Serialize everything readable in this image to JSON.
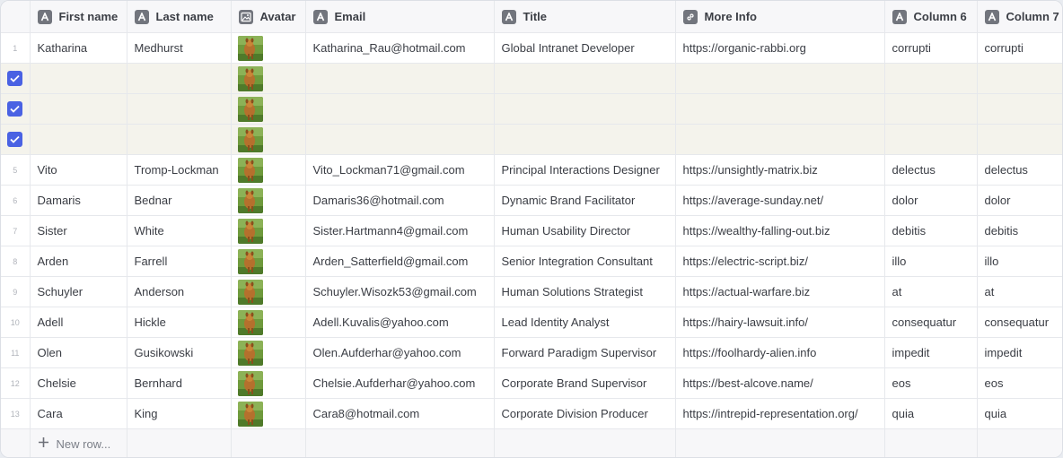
{
  "columns": [
    {
      "label": "First name",
      "icon": "text-type-icon"
    },
    {
      "label": "Last name",
      "icon": "text-type-icon"
    },
    {
      "label": "Avatar",
      "icon": "image-type-icon"
    },
    {
      "label": "Email",
      "icon": "text-type-icon"
    },
    {
      "label": "Title",
      "icon": "text-type-icon"
    },
    {
      "label": "More Info",
      "icon": "link-type-icon"
    },
    {
      "label": "Column 6",
      "icon": "text-type-icon"
    },
    {
      "label": "Column 7",
      "icon": "text-type-icon"
    }
  ],
  "rows": [
    {
      "num": "1",
      "selected": false,
      "first": "Katharina",
      "last": "Medhurst",
      "email": "Katharina_Rau@hotmail.com",
      "title": "Global Intranet Developer",
      "info": "https://organic-rabbi.org",
      "c6": "corrupti",
      "c7": "corrupti"
    },
    {
      "num": "",
      "selected": true,
      "first": "",
      "last": "",
      "email": "",
      "title": "",
      "info": "",
      "c6": "",
      "c7": ""
    },
    {
      "num": "",
      "selected": true,
      "first": "",
      "last": "",
      "email": "",
      "title": "",
      "info": "",
      "c6": "",
      "c7": ""
    },
    {
      "num": "",
      "selected": true,
      "first": "",
      "last": "",
      "email": "",
      "title": "",
      "info": "",
      "c6": "",
      "c7": ""
    },
    {
      "num": "5",
      "selected": false,
      "first": "Vito",
      "last": "Tromp-Lockman",
      "email": "Vito_Lockman71@gmail.com",
      "title": "Principal Interactions Designer",
      "info": "https://unsightly-matrix.biz",
      "c6": "delectus",
      "c7": "delectus"
    },
    {
      "num": "6",
      "selected": false,
      "first": "Damaris",
      "last": "Bednar",
      "email": "Damaris36@hotmail.com",
      "title": "Dynamic Brand Facilitator",
      "info": "https://average-sunday.net/",
      "c6": "dolor",
      "c7": "dolor"
    },
    {
      "num": "7",
      "selected": false,
      "first": "Sister",
      "last": "White",
      "email": "Sister.Hartmann4@gmail.com",
      "title": "Human Usability Director",
      "info": "https://wealthy-falling-out.biz",
      "c6": "debitis",
      "c7": "debitis"
    },
    {
      "num": "8",
      "selected": false,
      "first": "Arden",
      "last": "Farrell",
      "email": "Arden_Satterfield@gmail.com",
      "title": "Senior Integration Consultant",
      "info": "https://electric-script.biz/",
      "c6": "illo",
      "c7": "illo"
    },
    {
      "num": "9",
      "selected": false,
      "first": "Schuyler",
      "last": "Anderson",
      "email": "Schuyler.Wisozk53@gmail.com",
      "title": "Human Solutions Strategist",
      "info": "https://actual-warfare.biz",
      "c6": "at",
      "c7": "at"
    },
    {
      "num": "10",
      "selected": false,
      "first": "Adell",
      "last": "Hickle",
      "email": "Adell.Kuvalis@yahoo.com",
      "title": "Lead Identity Analyst",
      "info": "https://hairy-lawsuit.info/",
      "c6": "consequatur",
      "c7": "consequatur"
    },
    {
      "num": "11",
      "selected": false,
      "first": "Olen",
      "last": "Gusikowski",
      "email": "Olen.Aufderhar@yahoo.com",
      "title": "Forward Paradigm Supervisor",
      "info": "https://foolhardy-alien.info",
      "c6": "impedit",
      "c7": "impedit"
    },
    {
      "num": "12",
      "selected": false,
      "first": "Chelsie",
      "last": "Bernhard",
      "email": "Chelsie.Aufderhar@yahoo.com",
      "title": "Corporate Brand Supervisor",
      "info": "https://best-alcove.name/",
      "c6": "eos",
      "c7": "eos"
    },
    {
      "num": "13",
      "selected": false,
      "first": "Cara",
      "last": "King",
      "email": "Cara8@hotmail.com",
      "title": "Corporate Division Producer",
      "info": "https://intrepid-representation.org/",
      "c6": "quia",
      "c7": "quia"
    }
  ],
  "new_row_label": "New row...",
  "colors": {
    "accent": "#4a62e3",
    "selected_row": "#f4f3ec",
    "header_bg": "#f7f7f9",
    "grid": "#e6e8ec"
  }
}
